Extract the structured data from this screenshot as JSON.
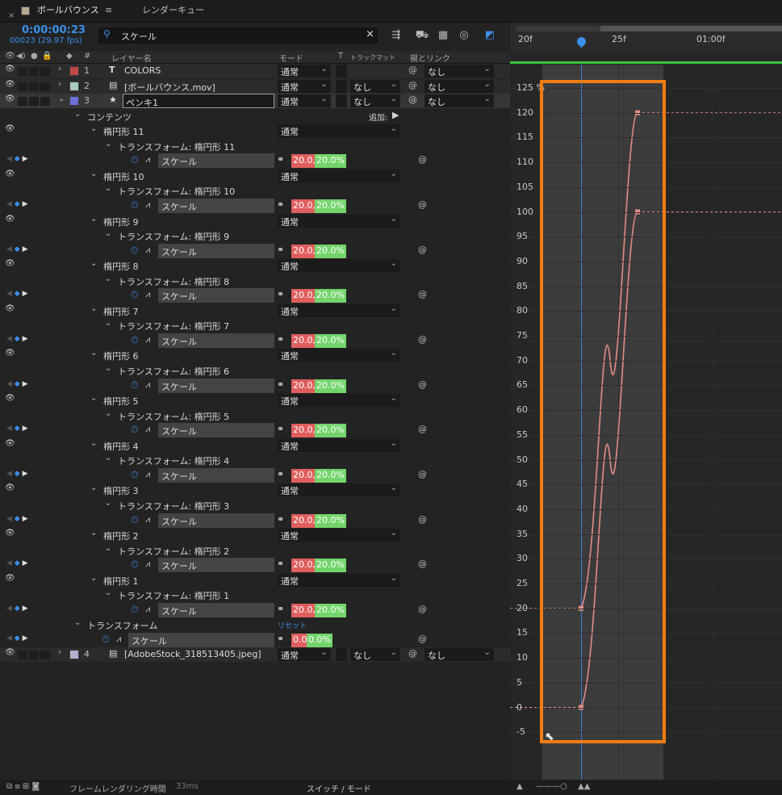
{
  "tabs": {
    "close": "×",
    "active_label": "ボールバウンス",
    "menu_icon": "≡",
    "other_label": "レンダーキュー"
  },
  "composition": {
    "timecode": "0:00:00:23",
    "frames": "00023 (29.97 fps)"
  },
  "search": {
    "value": "スケール",
    "clear": "×"
  },
  "columns": {
    "number": "#",
    "layer_name": "レイヤー名",
    "mode": "モード",
    "t": "T",
    "track_matte": "トラックマット",
    "parent_link": "親とリンク"
  },
  "layers": [
    {
      "num": "1",
      "type": "T",
      "name": "COLORS",
      "mode": "通常",
      "parent": "なし",
      "label_color": "#c04848"
    },
    {
      "num": "2",
      "type": "▤",
      "name": "[ボールバウンス.mov]",
      "mode": "通常",
      "track_matte": "なし",
      "parent": "なし",
      "label_color": "#a8c8c0"
    },
    {
      "num": "3",
      "type": "★",
      "name": "ペンキ1",
      "mode": "通常",
      "track_matte": "なし",
      "parent": "なし",
      "label_color": "#6c70d8"
    },
    {
      "num": "4",
      "type": "▤",
      "name": "[AdobeStock_318513405.jpeg]",
      "mode": "通常",
      "track_matte": "なし",
      "parent": "なし",
      "label_color": "#b0b0d0"
    }
  ],
  "contents": {
    "label": "コンテンツ",
    "add": "追加:",
    "groups": [
      {
        "name": "楕円形 11",
        "transform": "トランスフォーム: 楕円形 11"
      },
      {
        "name": "楕円形 10",
        "transform": "トランスフォーム: 楕円形 10"
      },
      {
        "name": "楕円形 9",
        "transform": "トランスフォーム: 楕円形 9"
      },
      {
        "name": "楕円形 8",
        "transform": "トランスフォーム: 楕円形 8"
      },
      {
        "name": "楕円形 7",
        "transform": "トランスフォーム: 楕円形 7"
      },
      {
        "name": "楕円形 6",
        "transform": "トランスフォーム: 楕円形 6"
      },
      {
        "name": "楕円形 5",
        "transform": "トランスフォーム: 楕円形 5"
      },
      {
        "name": "楕円形 4",
        "transform": "トランスフォーム: 楕円形 4"
      },
      {
        "name": "楕円形 3",
        "transform": "トランスフォーム: 楕円形 3"
      },
      {
        "name": "楕円形 2",
        "transform": "トランスフォーム: 楕円形 2"
      },
      {
        "name": "楕円形 1",
        "transform": "トランスフォーム: 楕円形 1"
      }
    ],
    "group_mode": "通常",
    "property": "スケール",
    "value_x": "20.0,",
    "value_y": "20.0%"
  },
  "layer_transform": {
    "label": "トランスフォーム",
    "reset": "リセット",
    "property": "スケール",
    "value_x": "0.0,",
    "value_y": "0.0%"
  },
  "status": {
    "frame_render": "フレームレンダリング時間",
    "render_ms": "33ms",
    "switches": "スイッチ / モード"
  },
  "ruler": {
    "labels": [
      "20f",
      "25f",
      "01:00f"
    ]
  },
  "graph": {
    "y_labels": [
      "125 %",
      "120",
      "115",
      "110",
      "105",
      "100",
      "95",
      "90",
      "85",
      "80",
      "75",
      "70",
      "65",
      "60",
      "55",
      "50",
      "45",
      "40",
      "35",
      "30",
      "25",
      "20",
      "15",
      "10",
      "5",
      "0",
      "-5"
    ],
    "curve_color": "#e58d86",
    "curves": [
      {
        "start_value": 20,
        "end_value": 120
      },
      {
        "start_value": 0,
        "end_value": 100
      }
    ]
  },
  "colors": {
    "accent": "#3b8eea",
    "highlight": "#f27c12",
    "value_red": "#e05e5e",
    "value_green": "#74d46c"
  },
  "icons": [
    "eye-icon",
    "audio-icon",
    "solo-icon",
    "lock-icon",
    "label-icon",
    "search-icon",
    "stopwatch-icon",
    "graph-icon",
    "chain-link-icon",
    "spiral-icon",
    "keyframe-diamond-icon"
  ]
}
